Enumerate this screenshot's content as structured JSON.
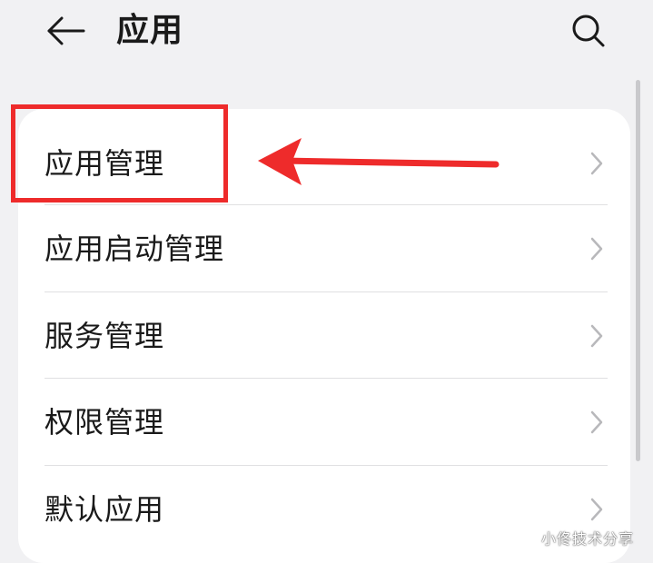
{
  "header": {
    "title": "应用"
  },
  "menu": {
    "items": [
      {
        "label": "应用管理"
      },
      {
        "label": "应用启动管理"
      },
      {
        "label": "服务管理"
      },
      {
        "label": "权限管理"
      },
      {
        "label": "默认应用"
      }
    ]
  },
  "annotation": {
    "color": "#ee2b2b"
  },
  "watermark": {
    "text": "小佟技术分享"
  },
  "icons": {
    "back": "arrow-left-icon",
    "search": "search-icon",
    "chevron": "chevron-right-icon"
  },
  "colors": {
    "background": "#f1f1f3",
    "card": "#ffffff",
    "text": "#1a1a1a",
    "chevron": "#b8b8bb",
    "annotation": "#ee2b2b"
  }
}
